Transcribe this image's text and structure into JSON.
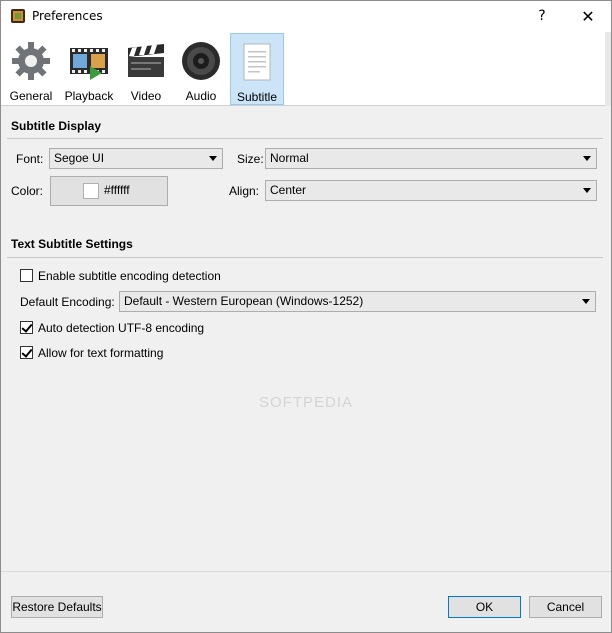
{
  "window": {
    "title": "Preferences",
    "help_label": "?",
    "close_label": "✕"
  },
  "toolbar": {
    "items": [
      {
        "label": "General",
        "icon": "gear-icon"
      },
      {
        "label": "Playback",
        "icon": "film-strip-icon"
      },
      {
        "label": "Video",
        "icon": "clapperboard-icon"
      },
      {
        "label": "Audio",
        "icon": "speaker-icon"
      },
      {
        "label": "Subtitle",
        "icon": "document-icon",
        "active": true
      }
    ]
  },
  "subtitle_display": {
    "title": "Subtitle Display",
    "font_label": "Font:",
    "font_value": "Segoe UI",
    "size_label": "Size:",
    "size_value": "Normal",
    "color_label": "Color:",
    "color_value": "#ffffff",
    "align_label": "Align:",
    "align_value": "Center"
  },
  "text_subtitle_settings": {
    "title": "Text Subtitle Settings",
    "enable_detection_label": "Enable subtitle encoding detection",
    "enable_detection_checked": false,
    "default_encoding_label": "Default Encoding:",
    "default_encoding_value": "Default - Western European (Windows-1252)",
    "auto_utf8_label": "Auto detection UTF-8 encoding",
    "auto_utf8_checked": true,
    "allow_formatting_label": "Allow for text formatting",
    "allow_formatting_checked": true
  },
  "footer": {
    "restore_label": "Restore Defaults",
    "ok_label": "OK",
    "cancel_label": "Cancel"
  },
  "watermark": "SOFTPEDIA",
  "colors": {
    "accent": "#0078d7",
    "active_tab_bg": "#cce4f7"
  }
}
